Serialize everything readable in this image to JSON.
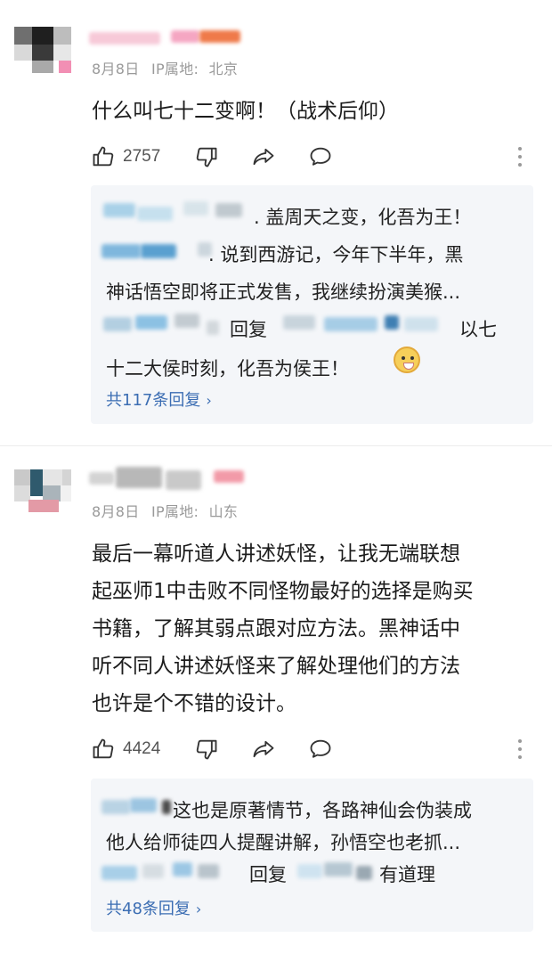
{
  "comments": [
    {
      "date": "8月8日",
      "ip_label": "IP属地:",
      "location": "北京",
      "text_lines": [
        "什么叫七十二变啊！（战术后仰）"
      ],
      "likes": "2757",
      "replies": {
        "lines": [
          {
            "segments": [
              ". 盖周天之变，化吾为王！"
            ]
          },
          {
            "segments": [
              ". 说到西游记，今年下半年，黑"
            ]
          },
          {
            "segments": [
              "神话悟空即将正式发售，我继续扮演美猴..."
            ]
          },
          {
            "segments": [
              "回复",
              "以七"
            ]
          },
          {
            "segments": [
              "十二大侯时刻，化吾为侯王！"
            ]
          }
        ],
        "view_all": "共117条回复"
      }
    },
    {
      "date": "8月8日",
      "ip_label": "IP属地:",
      "location": "山东",
      "text_lines": [
        "最后一幕听道人讲述妖怪，让我无端联想",
        "起巫师1中击败不同怪物最好的选择是购买",
        "书籍，了解其弱点跟对应方法。黑神话中",
        "听不同人讲述妖怪来了解处理他们的方法",
        "也许是个不错的设计。"
      ],
      "likes": "4424",
      "replies": {
        "lines": [
          {
            "segments": [
              "这也是原著情节，各路神仙会伪装成"
            ]
          },
          {
            "segments": [
              "他人给师徒四人提醒讲解，孙悟空也老抓..."
            ]
          },
          {
            "segments": [
              "回复",
              "有道理"
            ]
          }
        ],
        "view_all": "共48条回复"
      }
    }
  ],
  "icons": {
    "like": "thumbs-up-icon",
    "dislike": "thumbs-down-icon",
    "share": "share-arrow-icon",
    "comment": "comment-bubble-icon",
    "more": "more-vertical-icon",
    "chevron": "chevron-right-icon",
    "emoji": "dog-face-emoji-icon"
  },
  "colors": {
    "link": "#3b6db3",
    "meta": "#9a9a9a",
    "reply_bg": "#f4f6f9"
  }
}
